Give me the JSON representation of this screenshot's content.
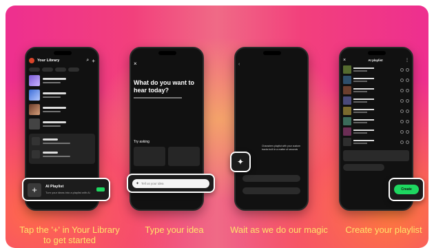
{
  "steps": [
    {
      "caption": "Tap the '+' in Your Library to get started"
    },
    {
      "caption": "Type your idea"
    },
    {
      "caption": "Wait as we do our magic"
    },
    {
      "caption": "Create your playlist"
    }
  ],
  "phone1": {
    "header_title": "Your Library",
    "callout_title": "AI Playlist",
    "callout_sub": "Turn your ideas into a playlist with AI",
    "plus_glyph": "+"
  },
  "phone2": {
    "question": "What do you want to hear today?",
    "section_label": "Try asking",
    "input_placeholder": "Tell us your idea"
  },
  "phone3": {
    "sparkle_glyph": "✦",
    "status_text": "Characters playlist with your custom tracks built in a matter of seconds"
  },
  "phone4": {
    "title": "AI playlist",
    "create_label": "Create"
  },
  "colors": {
    "caption": "#ffe36a",
    "spotify_green": "#1ed760"
  }
}
